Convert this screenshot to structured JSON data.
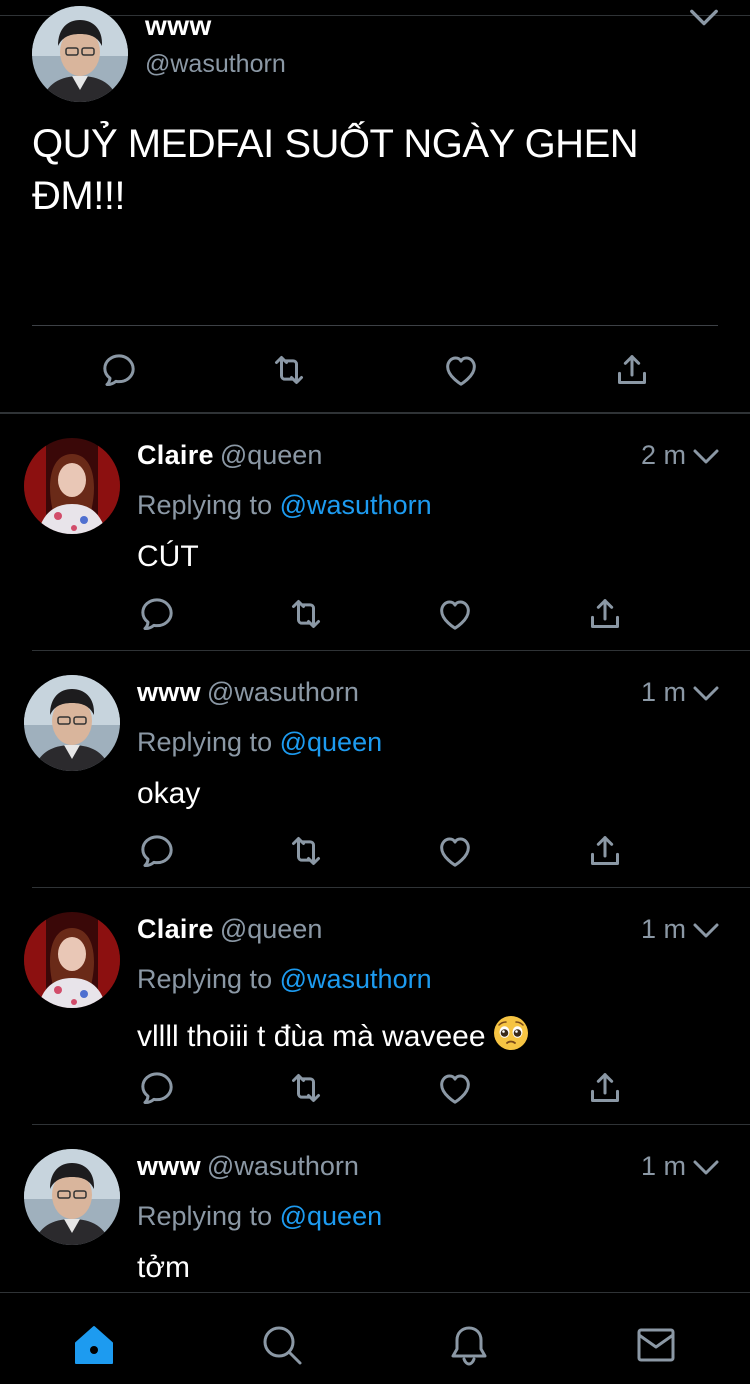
{
  "main_tweet": {
    "name": "www",
    "handle": "@wasuthorn",
    "text": "QUỶ MEDFAI SUỐT NGÀY GHEN ĐM!!!",
    "avatar_icon": "avatar-man-photo"
  },
  "replies": [
    {
      "name": "Claire",
      "handle": "@queen",
      "time": "2 m",
      "replying_label": "Replying to",
      "mention": "@wasuthorn",
      "text": "CÚT",
      "avatar_icon": "avatar-woman-photo"
    },
    {
      "name": "www",
      "handle": "@wasuthorn",
      "time": "1 m",
      "replying_label": "Replying to",
      "mention": "@queen",
      "text": "okay",
      "avatar_icon": "avatar-man-photo"
    },
    {
      "name": "Claire",
      "handle": "@queen",
      "time": "1 m",
      "replying_label": "Replying to",
      "mention": "@wasuthorn",
      "text": "vllll thoiii t đùa mà waveee",
      "emoji": "pleading-face-emoji",
      "avatar_icon": "avatar-woman-photo"
    },
    {
      "name": "www",
      "handle": "@wasuthorn",
      "time": "1 m",
      "replying_label": "Replying to",
      "mention": "@queen",
      "text": "tởm",
      "avatar_icon": "avatar-man-photo"
    }
  ],
  "actions": [
    "reply-icon",
    "retweet-icon",
    "like-icon",
    "share-icon"
  ],
  "bottom_nav": [
    {
      "name": "home",
      "icon": "home-icon",
      "active": true
    },
    {
      "name": "search",
      "icon": "search-icon",
      "active": false
    },
    {
      "name": "notifications",
      "icon": "bell-icon",
      "active": false
    },
    {
      "name": "messages",
      "icon": "mail-icon",
      "active": false
    }
  ],
  "colors": {
    "background": "#000000",
    "accent": "#1d9bf0",
    "secondary_text": "#8b98a5",
    "icon": "#8b98a5",
    "divider": "#2f3336"
  }
}
